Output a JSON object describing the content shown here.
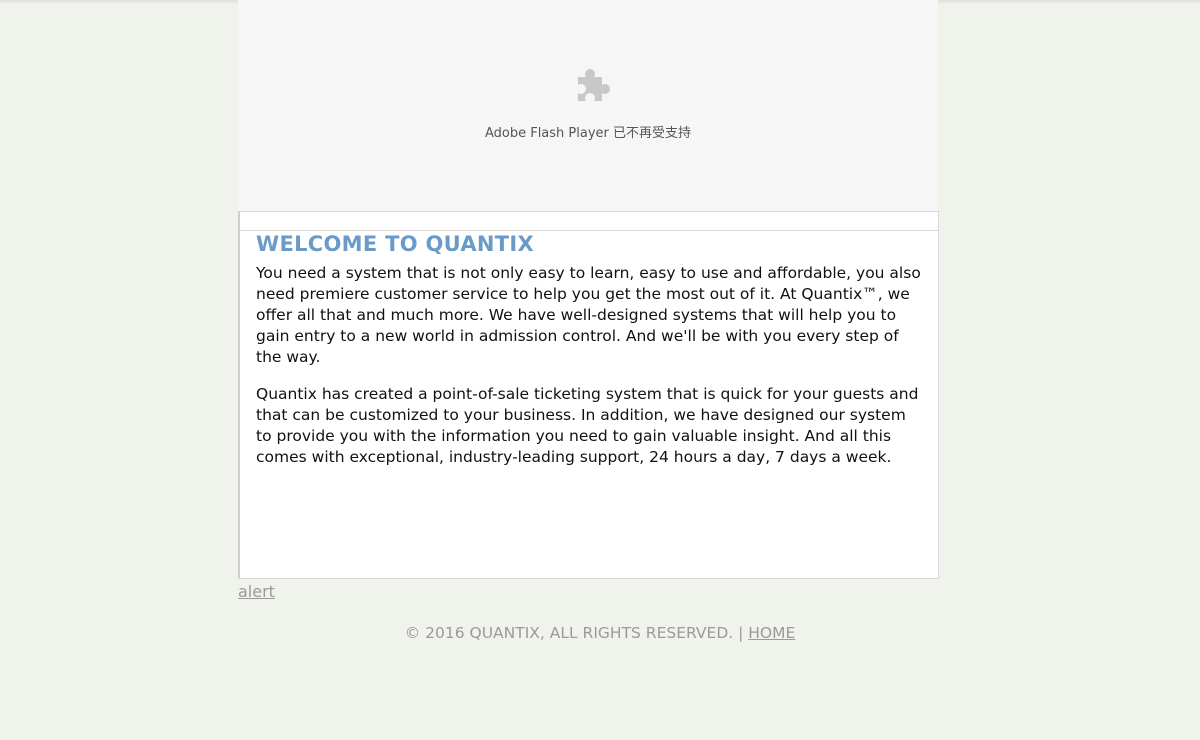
{
  "plugin": {
    "icon": "puzzle-icon",
    "message": "Adobe Flash Player 已不再受支持"
  },
  "content": {
    "title": "WELCOME TO QUANTIX",
    "paragraphs": [
      "You need a system that is not only easy to learn, easy to use and affordable, you also need premiere customer service to help you get the most out of it. At Quantix™, we offer all that and much more. We have well-designed systems that will help you to gain entry to a new world in admission control. And we'll be with you every step of the way.",
      "Quantix has created a point-of-sale ticketing system that is quick for your guests and that can be customized to your business. In addition, we have designed our system to provide you with the information you need to gain valuable insight. And all this comes with exceptional, industry-leading support, 24 hours a day, 7 days a week."
    ]
  },
  "alert_link": "alert",
  "footer": {
    "copyright": "© 2016 QUANTIX, ALL RIGHTS RESERVED. |",
    "home_link": "HOME"
  },
  "colors": {
    "page_background": "#f0f2ec",
    "title_blue": "#6a9bc8",
    "muted_text": "#9a9a9a"
  }
}
